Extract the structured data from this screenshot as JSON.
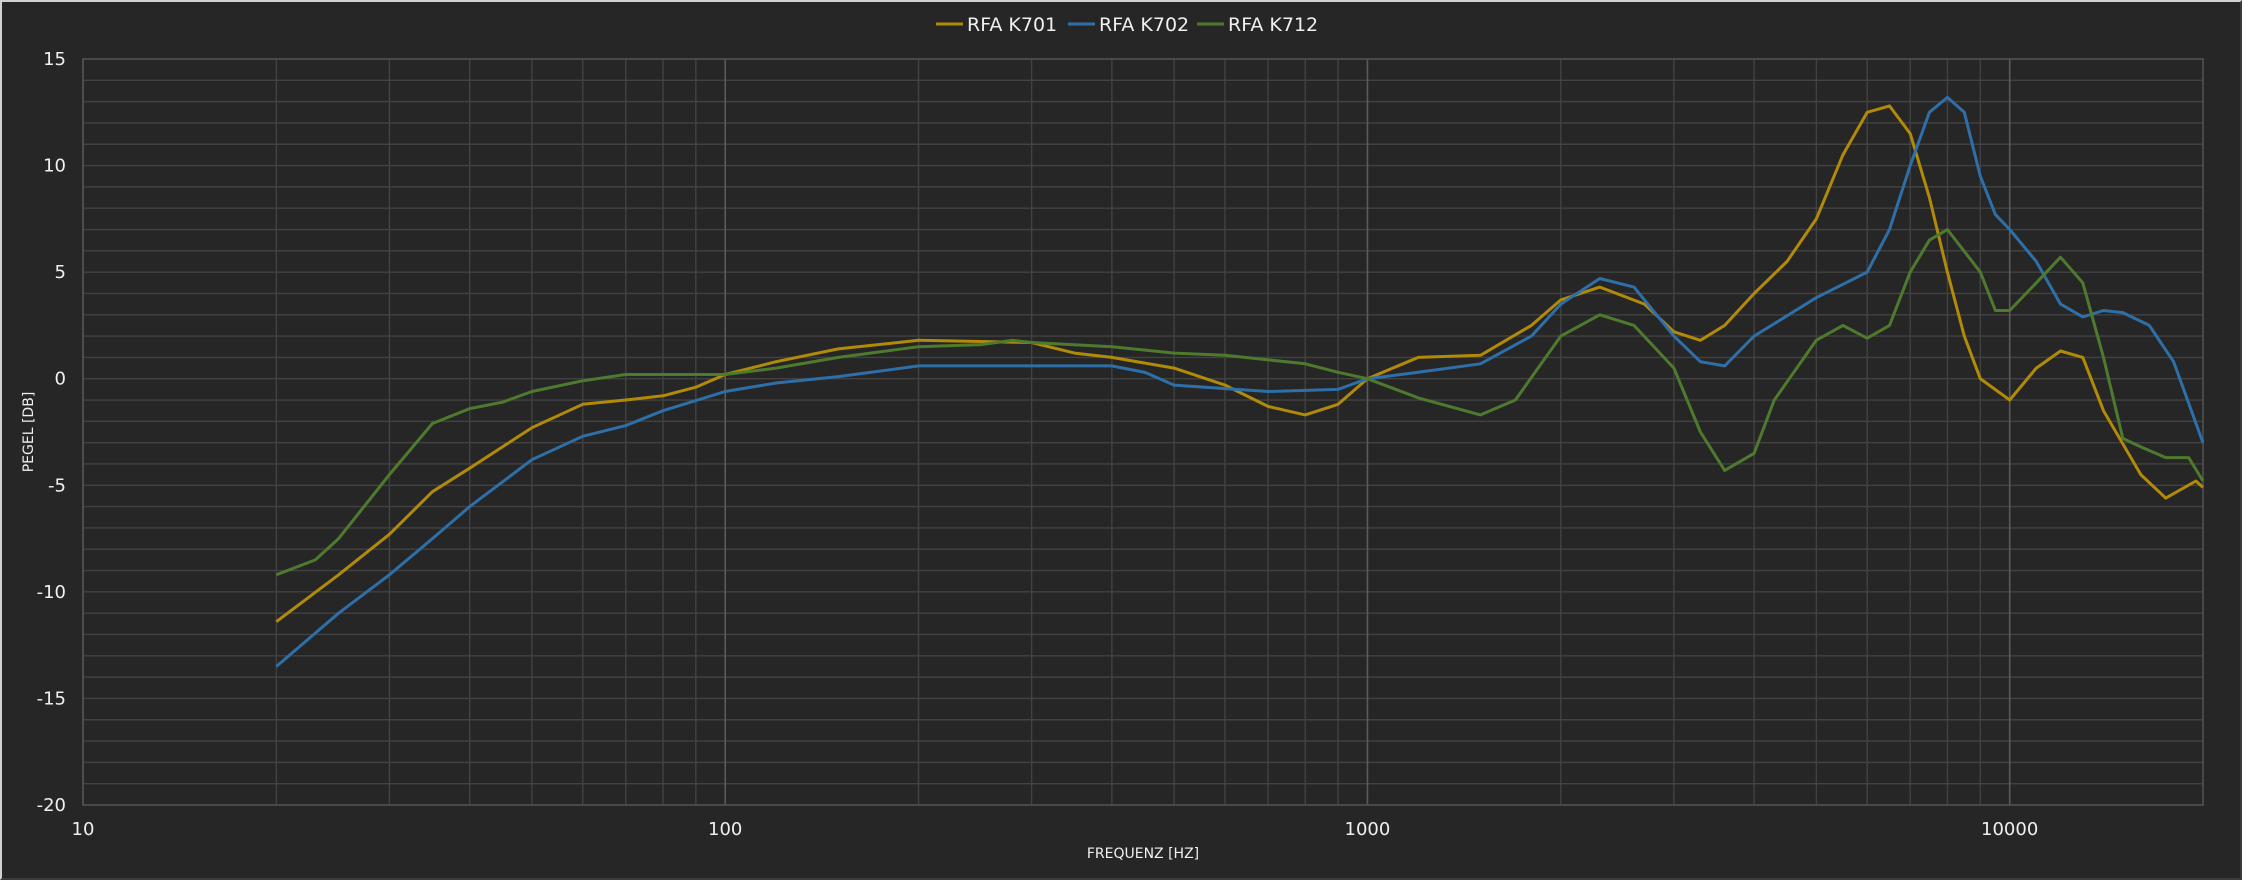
{
  "chart_data": {
    "type": "line",
    "title": "",
    "xlabel": "FREQUENZ [HZ]",
    "ylabel": "PEGEL [DB]",
    "xscale": "log",
    "xlim": [
      10,
      20000
    ],
    "ylim": [
      -20,
      15
    ],
    "x_ticks": [
      10,
      100,
      1000,
      10000
    ],
    "x_tick_labels": [
      "10",
      "100",
      "1000",
      "10000"
    ],
    "y_ticks": [
      15,
      10,
      5,
      0,
      -5,
      -10,
      -15,
      -20
    ],
    "y_tick_labels": [
      "15",
      "10",
      "5",
      "0",
      "-5",
      "-10",
      "-15",
      "-20"
    ],
    "grid": true,
    "legend_position": "top-center",
    "series": [
      {
        "name": "RFA K701",
        "color": "#B08A08",
        "x": [
          20,
          25,
          30,
          35,
          40,
          50,
          60,
          70,
          80,
          90,
          100,
          120,
          150,
          200,
          300,
          350,
          400,
          500,
          600,
          700,
          800,
          900,
          1000,
          1200,
          1500,
          1800,
          2000,
          2300,
          2700,
          3000,
          3300,
          3600,
          4000,
          4500,
          5000,
          5500,
          6000,
          6500,
          7000,
          7500,
          8000,
          8500,
          9000,
          10000,
          11000,
          12000,
          13000,
          14000,
          16000,
          17500,
          19500,
          20000
        ],
        "y": [
          -11.4,
          -9.2,
          -7.3,
          -5.3,
          -4.2,
          -2.3,
          -1.2,
          -1.0,
          -0.8,
          -0.4,
          0.2,
          0.8,
          1.4,
          1.8,
          1.7,
          1.2,
          1.0,
          0.5,
          -0.3,
          -1.3,
          -1.7,
          -1.2,
          0,
          1.0,
          1.1,
          2.5,
          3.7,
          4.3,
          3.5,
          2.2,
          1.8,
          2.5,
          4.0,
          5.5,
          7.5,
          10.5,
          12.5,
          12.8,
          11.5,
          8.5,
          5.0,
          2.0,
          0.0,
          -1.0,
          0.5,
          1.3,
          1.0,
          -1.5,
          -4.5,
          -5.6,
          -4.8,
          -5.1
        ]
      },
      {
        "name": "RFA K702",
        "color": "#2E6FA8",
        "x": [
          20,
          25,
          30,
          35,
          40,
          50,
          60,
          70,
          80,
          100,
          120,
          150,
          200,
          400,
          450,
          500,
          700,
          900,
          1000,
          1200,
          1500,
          1800,
          2000,
          2300,
          2600,
          3000,
          3300,
          3600,
          4000,
          5000,
          6000,
          6500,
          7000,
          7500,
          8000,
          8500,
          9000,
          9500,
          10000,
          11000,
          12000,
          13000,
          14000,
          15000,
          16500,
          18000,
          20000
        ],
        "y": [
          -13.5,
          -11.0,
          -9.2,
          -7.5,
          -6.0,
          -3.8,
          -2.7,
          -2.2,
          -1.5,
          -0.6,
          -0.2,
          0.1,
          0.6,
          0.6,
          0.3,
          -0.3,
          -0.6,
          -0.5,
          0,
          0.3,
          0.7,
          2.0,
          3.5,
          4.7,
          4.3,
          2.0,
          0.8,
          0.6,
          2.0,
          3.8,
          5.0,
          7.0,
          10.0,
          12.5,
          13.2,
          12.5,
          9.5,
          7.7,
          7.0,
          5.5,
          3.5,
          2.9,
          3.2,
          3.1,
          2.5,
          0.8,
          -3.0
        ]
      },
      {
        "name": "RFA K712",
        "color": "#4E7A2E",
        "x": [
          20,
          23,
          25,
          30,
          35,
          40,
          45,
          50,
          60,
          70,
          100,
          120,
          150,
          200,
          250,
          280,
          300,
          400,
          500,
          600,
          800,
          900,
          1000,
          1200,
          1500,
          1700,
          2000,
          2300,
          2600,
          3000,
          3300,
          3600,
          4000,
          4300,
          5000,
          5500,
          6000,
          6500,
          7000,
          7500,
          8000,
          9000,
          9500,
          10000,
          11000,
          12000,
          13000,
          14000,
          15000,
          16000,
          17500,
          19000,
          20000
        ],
        "y": [
          -9.2,
          -8.5,
          -7.5,
          -4.5,
          -2.1,
          -1.4,
          -1.1,
          -0.6,
          -0.1,
          0.2,
          0.2,
          0.5,
          1.0,
          1.5,
          1.6,
          1.8,
          1.7,
          1.5,
          1.2,
          1.1,
          0.7,
          0.3,
          0,
          -0.9,
          -1.7,
          -1.0,
          2.0,
          3.0,
          2.5,
          0.5,
          -2.5,
          -4.3,
          -3.5,
          -1.0,
          1.8,
          2.5,
          1.9,
          2.5,
          5.0,
          6.5,
          7.0,
          5.0,
          3.2,
          3.2,
          4.5,
          5.7,
          4.5,
          1.0,
          -2.8,
          -3.2,
          -3.7,
          -3.7,
          -4.8
        ]
      }
    ]
  }
}
